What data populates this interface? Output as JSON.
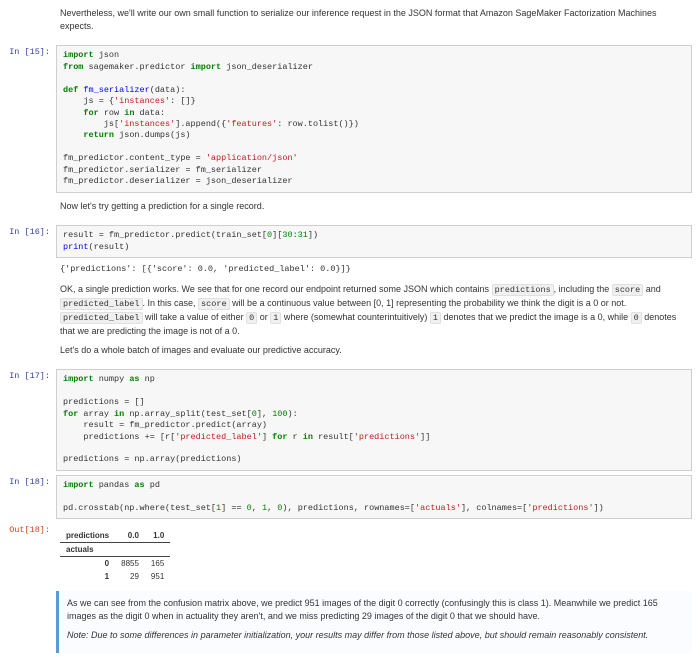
{
  "intro_text": "Nevertheless, we'll write our own small function to serialize our inference request in the JSON format that Amazon SageMaker Factorization Machines expects.",
  "cells": [
    {
      "prompt": "In [15]:",
      "code_tokens": [
        [
          [
            "kw-green",
            "import"
          ],
          [
            "nm",
            " json"
          ]
        ],
        [
          [
            "kw-green",
            "from"
          ],
          [
            "nm",
            " sagemaker.predictor "
          ],
          [
            "kw-green",
            "import"
          ],
          [
            "nm",
            " json_deserializer"
          ]
        ],
        [],
        [
          [
            "kw-green",
            "def"
          ],
          [
            "nm",
            " "
          ],
          [
            "kw-blue",
            "fm_serializer"
          ],
          [
            "nm",
            "(data):"
          ]
        ],
        [
          [
            "nm",
            "    js = {"
          ],
          [
            "sq",
            "'instances'"
          ],
          [
            "nm",
            ": []}"
          ]
        ],
        [
          [
            "nm",
            "    "
          ],
          [
            "kw-green",
            "for"
          ],
          [
            "nm",
            " row "
          ],
          [
            "kw-green",
            "in"
          ],
          [
            "nm",
            " data:"
          ]
        ],
        [
          [
            "nm",
            "        js["
          ],
          [
            "sq",
            "'instances'"
          ],
          [
            "nm",
            "].append({"
          ],
          [
            "sq",
            "'features'"
          ],
          [
            "nm",
            ": row.tolist()})"
          ]
        ],
        [
          [
            "nm",
            "    "
          ],
          [
            "kw-green",
            "return"
          ],
          [
            "nm",
            " json.dumps(js)"
          ]
        ],
        [],
        [
          [
            "nm",
            "fm_predictor.content_type = "
          ],
          [
            "sq",
            "'application/json'"
          ]
        ],
        [
          [
            "nm",
            "fm_predictor.serializer = fm_serializer"
          ]
        ],
        [
          [
            "nm",
            "fm_predictor.deserializer = json_deserializer"
          ]
        ]
      ]
    }
  ],
  "text1": "Now let's try getting a prediction for a single record.",
  "cell16": {
    "prompt": "In [16]:",
    "code_tokens": [
      [
        [
          "nm",
          "result = fm_predictor.predict(train_set["
        ],
        [
          "num",
          "0"
        ],
        [
          "nm",
          "]["
        ],
        [
          "num",
          "30"
        ],
        [
          "nm",
          ":"
        ],
        [
          "num",
          "31"
        ],
        [
          "nm",
          "])"
        ]
      ],
      [
        [
          "bn",
          "print"
        ],
        [
          "nm",
          "(result)"
        ]
      ]
    ],
    "output": "{'predictions': [{'score': 0.0, 'predicted_label': 0.0}]}"
  },
  "text2": {
    "p1a": "OK, a single prediction works. We see that for one record our endpoint returned some JSON which contains ",
    "predictions": "predictions",
    "p1b": ", including the ",
    "score": "score",
    "p1c": " and ",
    "predicted_label": "predicted_label",
    "p1d": ". In this case, ",
    "score2": "score",
    "p1e": " will be a continuous value between [0, 1] representing the probability we think the digit is a 0 or not. ",
    "predicted_label2": "predicted_label",
    "p1f": " will take a value of either ",
    "zero": "0",
    "p1g": " or ",
    "one": "1",
    "p1h": " where (somewhat counterintuitively) ",
    "one2": "1",
    "p1i": " denotes that we predict the image is a 0, while ",
    "zero2": "0",
    "p1j": " denotes that we are predicting the image is not of a 0.",
    "p2": "Let's do a whole batch of images and evaluate our predictive accuracy."
  },
  "cell17": {
    "prompt": "In [17]:",
    "code_tokens": [
      [
        [
          "kw-green",
          "import"
        ],
        [
          "nm",
          " numpy "
        ],
        [
          "kw-green",
          "as"
        ],
        [
          "nm",
          " np"
        ]
      ],
      [],
      [
        [
          "nm",
          "predictions = []"
        ]
      ],
      [
        [
          "kw-green",
          "for"
        ],
        [
          "nm",
          " array "
        ],
        [
          "kw-green",
          "in"
        ],
        [
          "nm",
          " np.array_split(test_set["
        ],
        [
          "num",
          "0"
        ],
        [
          "nm",
          "], "
        ],
        [
          "num",
          "100"
        ],
        [
          "nm",
          "):"
        ]
      ],
      [
        [
          "nm",
          "    result = fm_predictor.predict(array)"
        ]
      ],
      [
        [
          "nm",
          "    predictions += [r["
        ],
        [
          "sq",
          "'predicted_label'"
        ],
        [
          "nm",
          "] "
        ],
        [
          "kw-green",
          "for"
        ],
        [
          "nm",
          " r "
        ],
        [
          "kw-green",
          "in"
        ],
        [
          "nm",
          " result["
        ],
        [
          "sq",
          "'predictions'"
        ],
        [
          "nm",
          "]]"
        ]
      ],
      [],
      [
        [
          "nm",
          "predictions = np.array(predictions)"
        ]
      ]
    ]
  },
  "cell18": {
    "prompt": "In [18]:",
    "code_tokens": [
      [
        [
          "kw-green",
          "import"
        ],
        [
          "nm",
          " pandas "
        ],
        [
          "kw-green",
          "as"
        ],
        [
          "nm",
          " pd"
        ]
      ],
      [],
      [
        [
          "nm",
          "pd.crosstab(np.where(test_set["
        ],
        [
          "num",
          "1"
        ],
        [
          "nm",
          "] == "
        ],
        [
          "num",
          "0"
        ],
        [
          "nm",
          ", "
        ],
        [
          "num",
          "1"
        ],
        [
          "nm",
          ", "
        ],
        [
          "num",
          "0"
        ],
        [
          "nm",
          "), predictions, rownames=["
        ],
        [
          "sq",
          "'actuals'"
        ],
        [
          "nm",
          "], colnames=["
        ],
        [
          "sq",
          "'predictions'"
        ],
        [
          "nm",
          "])"
        ]
      ]
    ],
    "out_prompt": "Out[18]:"
  },
  "table": {
    "col_label": "predictions",
    "row_label": "actuals",
    "cols": [
      "0.0",
      "1.0"
    ],
    "rows": [
      {
        "idx": "0",
        "v": [
          "8855",
          "165"
        ]
      },
      {
        "idx": "1",
        "v": [
          "29",
          "951"
        ]
      }
    ]
  },
  "note": {
    "p1": "As we can see from the confusion matrix above, we predict 951 images of the digit 0 correctly (confusingly this is class 1). Meanwhile we predict 165 images as the digit 0 when in actuality they aren't, and we miss predicting 29 images of the digit 0 that we should have.",
    "p2": "Note: Due to some differences in parameter initialization, your results may differ from those listed above, but should remain reasonably consistent."
  }
}
